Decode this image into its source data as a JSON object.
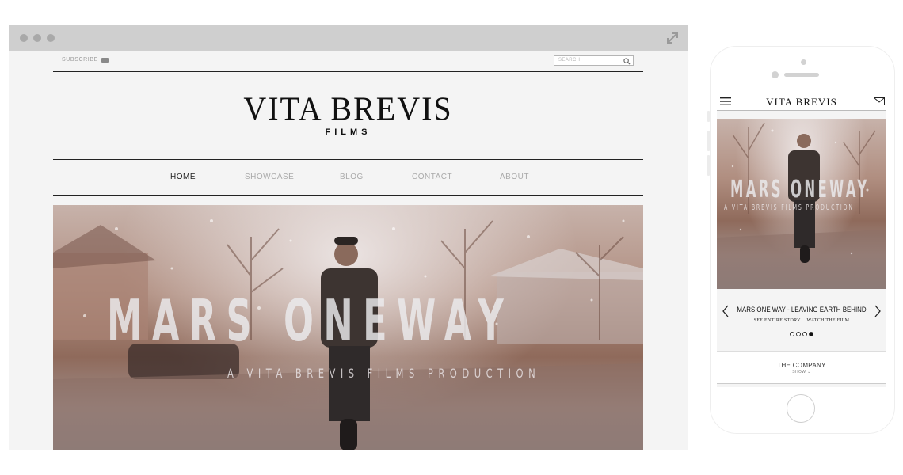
{
  "desktop": {
    "header": {
      "subscribe_label": "SUBSCRIBE",
      "search_placeholder": "SEARCH"
    },
    "logo": {
      "title": "VITA BREVIS",
      "subtitle": "FILMS"
    },
    "nav": {
      "items": [
        "HOME",
        "SHOWCASE",
        "BLOG",
        "CONTACT",
        "ABOUT"
      ],
      "active": "HOME"
    },
    "hero": {
      "title": "MARS ONEWAY",
      "subtitle": "A VITA BREVIS FILMS PRODUCTION"
    }
  },
  "mobile": {
    "header": {
      "logo": "VITA BREVIS"
    },
    "hero": {
      "title": "MARS ONEWAY",
      "subtitle": "A VITA BREVIS FILMS PRODUCTION"
    },
    "slide": {
      "caption": "MARS ONE WAY - LEAVING EARTH BEHIND",
      "link_story": "SEE ENTIRE STORY",
      "link_film": "WATCH THE FILM",
      "dots_total": 4,
      "active_dot": 4
    },
    "company": {
      "label": "THE COMPANY",
      "toggle": "SHOW"
    }
  },
  "colors": {
    "page_bg": "#f4f4f4",
    "browser_bar": "#cfcfcf",
    "text_dark": "#111111",
    "nav_inactive": "#aaaaaa"
  },
  "icons": [
    "expand-icon",
    "mail-icon",
    "search-icon",
    "hamburger-menu-icon",
    "chevron-left-icon",
    "chevron-right-icon",
    "chevron-down-icon"
  ]
}
